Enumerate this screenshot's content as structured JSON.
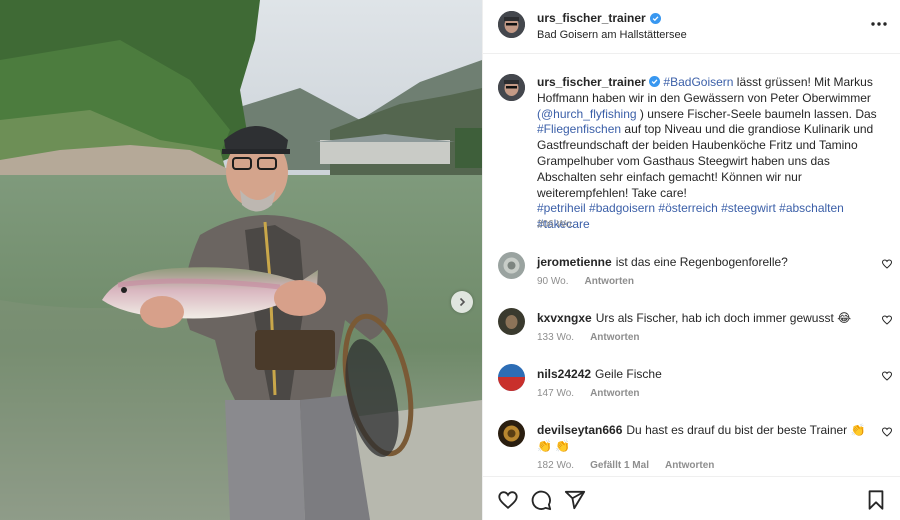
{
  "post": {
    "username": "urs_fischer_trainer",
    "location": "Bad Goisern am Hallstättersee",
    "verified": true,
    "caption": {
      "username": "urs_fischer_trainer",
      "p1": "#BadGoisern",
      "p2": " lässt grüssen! Mit Markus Hoffmann haben wir in den Gewässern von Peter Oberwimmer ",
      "p3": "(@hurch_flyfishing",
      "p4": " ) unsere Fischer-Seele baumeln lassen. Das ",
      "p5": "#Fliegenfischen",
      "p6": " auf top Niveau und die grandiose Kulinarik und Gastfreundschaft der beiden Haubenköche Fritz und Tamino Grampelhuber vom Gasthaus Steegwirt haben uns das Abschalten sehr einfach gemacht! Können wir nur weiterempfehlen! Take care!",
      "p7": "#petriheil #badgoisern #österreich #steegwirt #abschalten #takecare",
      "time": "206 Wo."
    }
  },
  "comments": [
    {
      "username": "jerometienne",
      "text": "ist das eine Regenbogenforelle?",
      "time": "90 Wo.",
      "likes": "",
      "reply": "Antworten"
    },
    {
      "username": "kxvxngxe",
      "text": "Urs als Fischer, hab ich doch immer gewusst 😂",
      "time": "133 Wo.",
      "likes": "",
      "reply": "Antworten"
    },
    {
      "username": "nils24242",
      "text": "Geile Fische",
      "time": "147 Wo.",
      "likes": "",
      "reply": "Antworten"
    },
    {
      "username": "devilseytan666",
      "text": "Du hast es drauf du bist der beste Trainer 👏 👏 👏",
      "time": "182 Wo.",
      "likes": "Gefällt 1 Mal",
      "reply": "Antworten"
    }
  ],
  "icons": {
    "more": "more-options-icon",
    "next": "chevron-right-icon",
    "like": "heart-icon",
    "comment": "comment-icon",
    "share": "paper-plane-icon",
    "save": "bookmark-icon"
  },
  "colors": {
    "link": "#3b5fa8",
    "verified": "#3897f0",
    "muted": "#8e8e8e"
  }
}
